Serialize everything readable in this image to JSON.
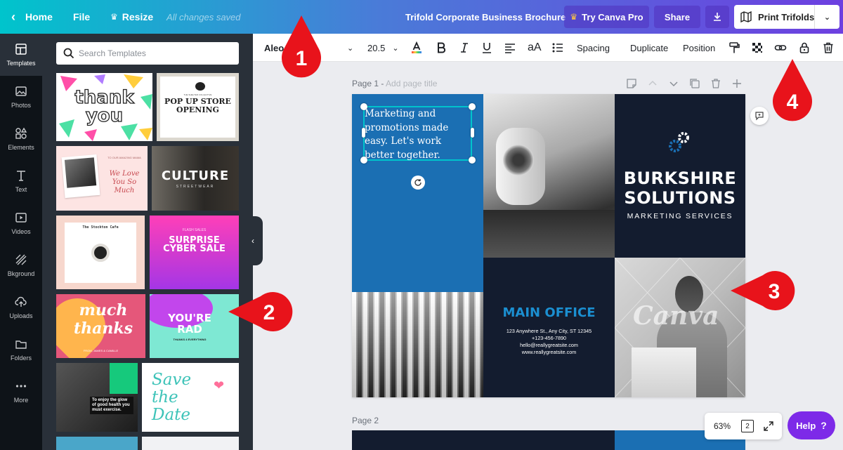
{
  "topbar": {
    "home": "Home",
    "file": "File",
    "resize": "Resize",
    "saved_status": "All changes saved",
    "doc_title": "Trifold Corporate Business Brochure",
    "try_pro": "Try Canva Pro",
    "share": "Share",
    "print": "Print Trifolds"
  },
  "rail": {
    "items": [
      {
        "label": "Templates",
        "icon": "templates-icon"
      },
      {
        "label": "Photos",
        "icon": "photos-icon"
      },
      {
        "label": "Elements",
        "icon": "elements-icon"
      },
      {
        "label": "Text",
        "icon": "text-icon"
      },
      {
        "label": "Videos",
        "icon": "videos-icon"
      },
      {
        "label": "Bkground",
        "icon": "background-icon"
      },
      {
        "label": "Uploads",
        "icon": "uploads-icon"
      },
      {
        "label": "Folders",
        "icon": "folders-icon"
      },
      {
        "label": "More",
        "icon": "more-icon"
      }
    ]
  },
  "templates": {
    "search_placeholder": "Search Templates",
    "t1": "thank you",
    "t2_small": "THE SHELTER COLLECTIVE",
    "t2": "POP UP STORE OPENING",
    "t3_small": "TO OUR AMAZING MAMA",
    "t3": "We Love You So Much",
    "t4": "CULTURE",
    "t4_sub": "STREETWEAR",
    "t5": "The Stockton Cafe",
    "t6_small": "FLASH SALES",
    "t6": "SURPRISE CYBER SALE",
    "t7": "much thanks",
    "t7_small": "FROM, JAMES & CAMILLE",
    "t8": "YOU'RE RAD",
    "t8_small": "THANKS 4 EVERYTHING",
    "t9_quote": "To enjoy the glow of good health you must exercise.",
    "t10": "Save the Date"
  },
  "toolbar": {
    "font": "Aleo",
    "font_size": "20.5",
    "case": "aA",
    "spacing": "Spacing",
    "duplicate": "Duplicate",
    "position": "Position"
  },
  "canvas": {
    "page1_label": "Page 1 -",
    "page1_hint": "Add page title",
    "page2_label": "Page 2",
    "text_box": "Marketing and promotions made easy. Let's work better together.",
    "company_line1": "BURKSHIRE",
    "company_line2": "SOLUTIONS",
    "company_sub": "MARKETING SERVICES",
    "main_office": "MAIN OFFICE",
    "address": "123 Anywhere St., Any City, ST 12345",
    "phone": "+123-456-7890",
    "email": "hello@reallygreatsite.com",
    "website": "www.reallygreatsite.com",
    "watermark": "Canva"
  },
  "footer": {
    "zoom": "63%",
    "page_count": "2",
    "help": "Help",
    "help_icon": "?"
  },
  "markers": [
    "1",
    "2",
    "3",
    "4"
  ],
  "colors": {
    "brand_purple": "#7d2ae8",
    "page_blue": "#1b6fb3",
    "navy": "#131c2f",
    "marker_red": "#e8131b"
  }
}
